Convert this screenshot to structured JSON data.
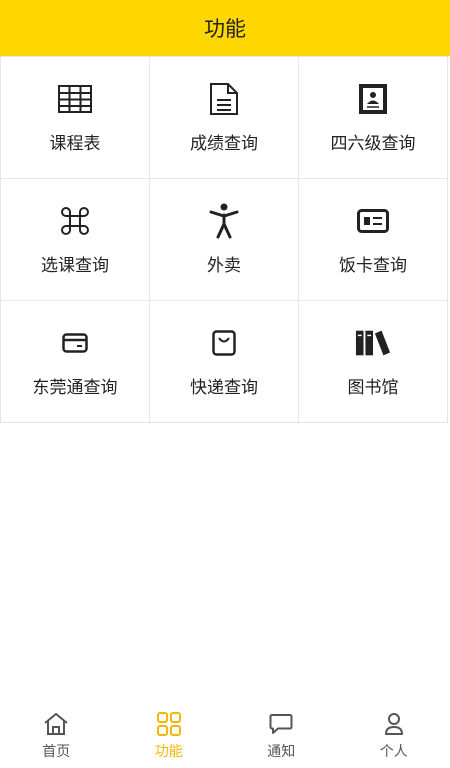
{
  "header": {
    "title": "功能"
  },
  "grid": {
    "items": [
      {
        "label": "课程表",
        "icon": "table-icon"
      },
      {
        "label": "成绩查询",
        "icon": "document-icon"
      },
      {
        "label": "四六级查询",
        "icon": "id-card-icon"
      },
      {
        "label": "选课查询",
        "icon": "command-icon"
      },
      {
        "label": "外卖",
        "icon": "person-icon"
      },
      {
        "label": "饭卡查询",
        "icon": "card-icon"
      },
      {
        "label": "东莞通查询",
        "icon": "credit-card-icon"
      },
      {
        "label": "快递查询",
        "icon": "package-icon"
      },
      {
        "label": "图书馆",
        "icon": "books-icon"
      }
    ]
  },
  "tabbar": {
    "tabs": [
      {
        "label": "首页",
        "icon": "home-icon",
        "active": false
      },
      {
        "label": "功能",
        "icon": "grid-icon",
        "active": true
      },
      {
        "label": "通知",
        "icon": "message-icon",
        "active": false
      },
      {
        "label": "个人",
        "icon": "user-icon",
        "active": false
      }
    ]
  },
  "colors": {
    "accent": "#FFD700",
    "active_tab": "#F2B705"
  }
}
